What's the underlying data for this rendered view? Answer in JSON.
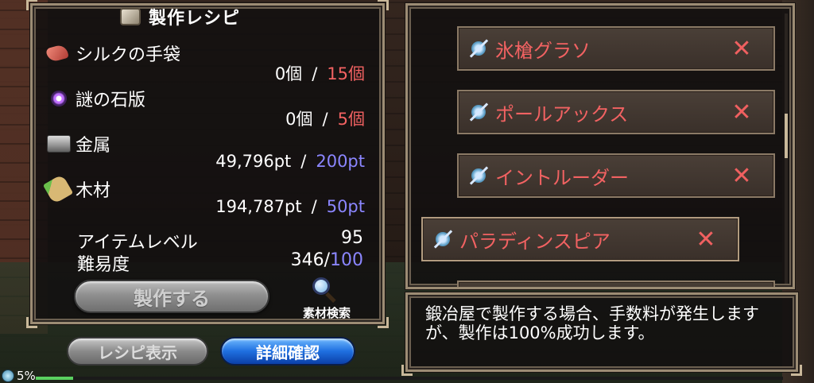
{
  "recipe": {
    "title": "製作レシピ",
    "materials": [
      {
        "name": "シルクの手袋",
        "icon": "silk-glove-icon",
        "have": "0個",
        "need": "15個"
      },
      {
        "name": "謎の石版",
        "icon": "mystery-tablet-icon",
        "have": "0個",
        "need": "5個"
      },
      {
        "name": "金属",
        "icon": "metal-ingot-icon",
        "have": "49,796pt",
        "need": "200pt"
      },
      {
        "name": "木材",
        "icon": "lumber-icon",
        "have": "194,787pt",
        "need": "50pt"
      }
    ],
    "separator": "/",
    "item_level_label": "アイテムレベル",
    "item_level_value": "95",
    "difficulty_label": "難易度",
    "difficulty_value": "346/",
    "difficulty_max": "100",
    "craft_button": "製作する",
    "material_search_label": "素材検索"
  },
  "bottom": {
    "recipe_display_button": "レシピ表示",
    "detail_button": "詳細確認",
    "exp_percent": "5%",
    "exp_fill": 0.05
  },
  "item_list": {
    "items": [
      {
        "name": "氷槍グラソ",
        "icon": "spear-icon",
        "action": "✕"
      },
      {
        "name": "ポールアックス",
        "icon": "spear-icon",
        "action": "✕"
      },
      {
        "name": "イントルーダー",
        "icon": "spear-icon",
        "action": "✕"
      },
      {
        "name": "パラディンスピア",
        "icon": "spear-icon",
        "action": "✕"
      }
    ]
  },
  "message": {
    "text": "鍛冶屋で製作する場合、手数料が発生しますが、製作は100%成功します。"
  },
  "colors": {
    "shortfall": "#f26262",
    "requirement": "#8b86ff",
    "detail_button": "#1f6fe0"
  }
}
